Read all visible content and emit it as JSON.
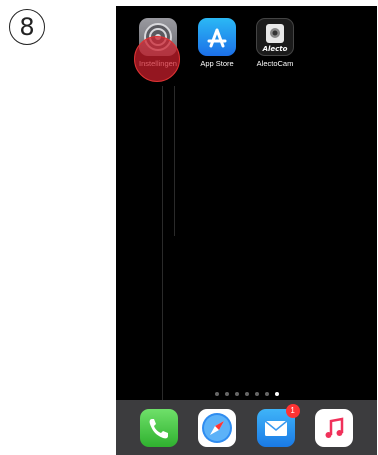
{
  "step_number": "8",
  "home_screen": {
    "apps": [
      {
        "label": "Instellingen",
        "icon": "settings-gear-icon"
      },
      {
        "label": "App Store",
        "icon": "app-store-icon"
      },
      {
        "label": "AlectoCam",
        "icon": "alectocam-icon",
        "logo_text": "Alecto"
      }
    ],
    "tap_highlight_color": "#cd1e2d"
  },
  "page_indicator": {
    "page_count": 7,
    "active_page": 7
  },
  "dock": {
    "apps": [
      {
        "name": "phone",
        "icon": "phone-icon"
      },
      {
        "name": "safari",
        "icon": "compass-icon"
      },
      {
        "name": "mail",
        "icon": "envelope-icon",
        "badge": "1"
      },
      {
        "name": "music",
        "icon": "music-note-icon"
      }
    ]
  }
}
